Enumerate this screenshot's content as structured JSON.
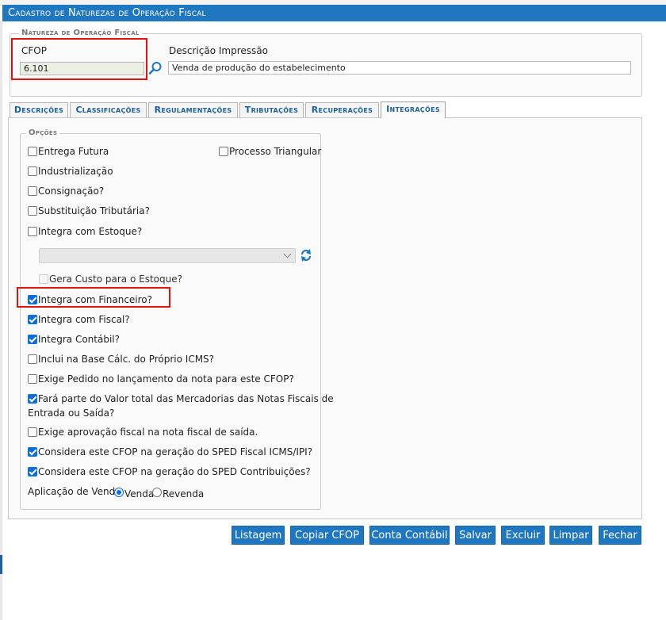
{
  "window": {
    "title": "Cadastro de Naturezas de Operação Fiscal"
  },
  "header": {
    "legend": "Natureza de Operação Fiscal",
    "cfop_label": "CFOP",
    "cfop_value": "6.101",
    "descricao_label": "Descrição Impressão",
    "descricao_value": "Venda de produção do estabelecimento"
  },
  "tabs": [
    {
      "label": "Descrições"
    },
    {
      "label": "Classificações"
    },
    {
      "label": "Regulamentações"
    },
    {
      "label": "Tributações"
    },
    {
      "label": "Recuperações"
    },
    {
      "label": "Integrações",
      "active": true
    }
  ],
  "options": {
    "legend": "Opções",
    "items": [
      {
        "label": "Entrega Futura",
        "checked": false
      },
      {
        "label": "Processo Triangular",
        "checked": false
      },
      {
        "label": "Industrialização",
        "checked": false
      },
      {
        "label": "Consignação?",
        "checked": false
      },
      {
        "label": "Substituição Tributária?",
        "checked": false
      },
      {
        "label": "Integra com Estoque?",
        "checked": false
      },
      {
        "label": "Gera Custo para o Estoque?",
        "checked": false,
        "disabled": true
      },
      {
        "label": "Integra com Financeiro?",
        "checked": true
      },
      {
        "label": "Integra com Fiscal?",
        "checked": true
      },
      {
        "label": "Integra Contábil?",
        "checked": true
      },
      {
        "label": "Inclui na Base Cálc. do Próprio ICMS?",
        "checked": false
      },
      {
        "label": "Exige Pedido no lançamento da nota para este CFOP?",
        "checked": false
      },
      {
        "label": "Fará parte do Valor total das Mercadorias das Notas Fiscais de",
        "label_line2": "Entrada ou Saída?",
        "checked": true
      },
      {
        "label": "Exige aprovação fiscal na nota fiscal de saída.",
        "checked": false
      },
      {
        "label": "Considera este CFOP na geração do SPED Fiscal ICMS/IPI?",
        "checked": true
      },
      {
        "label": "Considera este CFOP na geração do SPED Contribuições?",
        "checked": true
      }
    ],
    "estoque_select": {
      "value": ""
    },
    "aplicacao": {
      "label": "Aplicação de Venda:",
      "choices": [
        {
          "label": "Venda",
          "selected": true
        },
        {
          "label": "Revenda",
          "selected": false
        }
      ]
    }
  },
  "buttons": {
    "listagem": "Listagem",
    "copiar": "Copiar CFOP",
    "conta": "Conta Contábil",
    "salvar": "Salvar",
    "excluir": "Excluir",
    "limpar": "Limpar",
    "fechar": "Fechar"
  },
  "colors": {
    "accent": "#1f78bf",
    "highlight": "#e01212",
    "checkbox": "#0a6fdb"
  }
}
